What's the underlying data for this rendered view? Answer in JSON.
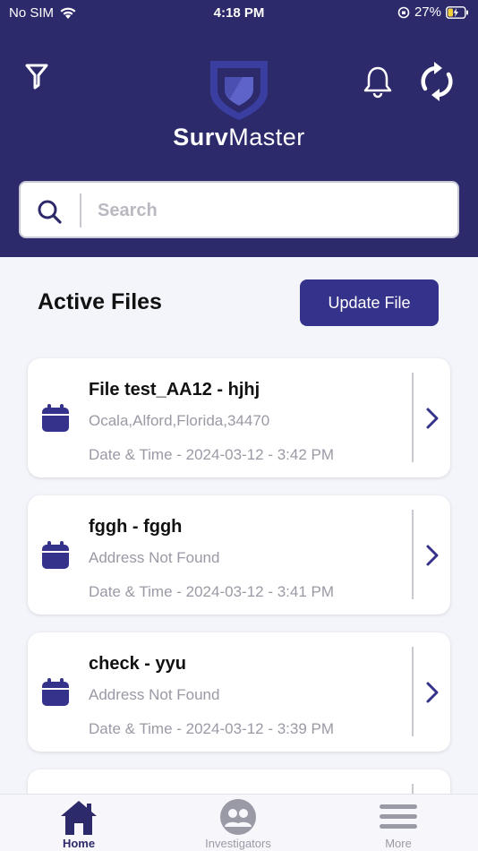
{
  "status_bar": {
    "carrier": "No SIM",
    "time": "4:18 PM",
    "battery": "27%"
  },
  "header": {
    "brand_bold": "Surv",
    "brand_rest": "Master"
  },
  "search": {
    "placeholder": "Search"
  },
  "main": {
    "section_title": "Active Files",
    "update_button": "Update File"
  },
  "files": [
    {
      "title": "File test_AA12 - hjhj",
      "address": "Ocala,Alford,Florida,34470",
      "date": "Date & Time - 2024-03-12 - 3:42 PM"
    },
    {
      "title": "fggh - fggh",
      "address": "Address Not Found",
      "date": "Date & Time - 2024-03-12 - 3:41 PM"
    },
    {
      "title": "check - yyu",
      "address": "Address Not Found",
      "date": "Date & Time - 2024-03-12 - 3:39 PM"
    },
    {
      "title": "",
      "address": "",
      "date": ""
    }
  ],
  "tabs": [
    {
      "label": "Home",
      "icon": "home-icon",
      "active": true
    },
    {
      "label": "Investigators",
      "icon": "investigators-icon",
      "active": false
    },
    {
      "label": "More",
      "icon": "menu-icon",
      "active": false
    }
  ],
  "colors": {
    "header_bg": "#2d2a6b",
    "accent": "#34328a",
    "muted_text": "#9a9aa6"
  }
}
